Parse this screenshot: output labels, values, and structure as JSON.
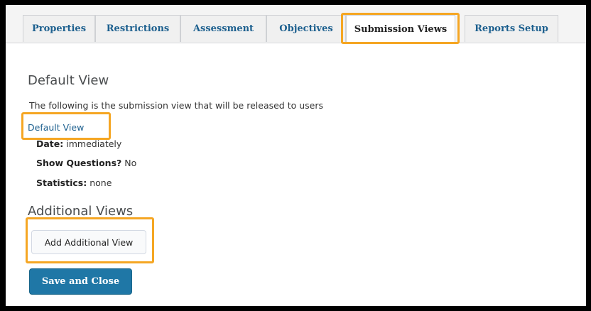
{
  "tabs": [
    {
      "label": "Properties"
    },
    {
      "label": "Restrictions"
    },
    {
      "label": "Assessment"
    },
    {
      "label": "Objectives"
    },
    {
      "label": "Submission Views",
      "active": true
    },
    {
      "label": "Reports Setup"
    }
  ],
  "default_view": {
    "heading": "Default View",
    "description": "The following is the submission view that will be released to users",
    "link": "Default View",
    "date_label": "Date:",
    "date_value": "immediately",
    "show_questions_label": "Show Questions?",
    "show_questions_value": "No",
    "statistics_label": "Statistics:",
    "statistics_value": "none"
  },
  "additional_views": {
    "heading": "Additional Views",
    "add_button": "Add Additional View"
  },
  "actions": {
    "save_close": "Save and Close"
  },
  "colors": {
    "highlight": "#f5a623",
    "link": "#1c5f8e",
    "primary_button": "#1f77a6"
  }
}
